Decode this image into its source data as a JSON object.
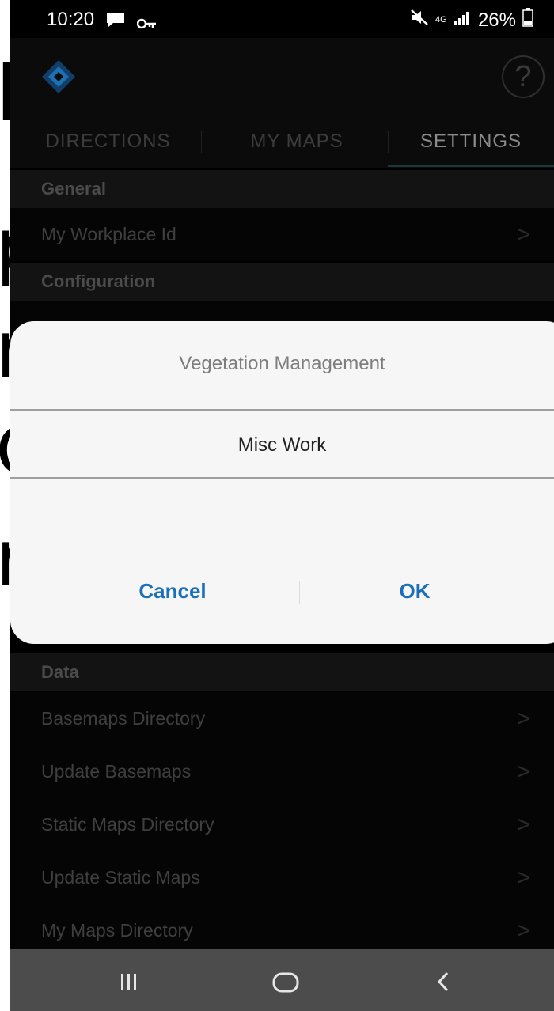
{
  "status_bar": {
    "time": "10:20",
    "network": "4G",
    "battery": "26%",
    "icons": [
      "chat-icon",
      "key-icon",
      "mute-icon",
      "signal-icon",
      "battery-icon"
    ]
  },
  "app_bar": {
    "logo_icon": "diamond-logo-icon",
    "help_icon": "help-icon",
    "help_glyph": "?"
  },
  "tabs": [
    {
      "label": "DIRECTIONS",
      "active": false
    },
    {
      "label": "MY MAPS",
      "active": false
    },
    {
      "label": "SETTINGS",
      "active": true
    }
  ],
  "sections": {
    "general": {
      "header": "General",
      "items": [
        {
          "label": "My Workplace Id"
        }
      ]
    },
    "configuration": {
      "header": "Configuration"
    },
    "data": {
      "header": "Data",
      "items": [
        {
          "label": "Basemaps Directory"
        },
        {
          "label": "Update Basemaps"
        },
        {
          "label": "Static Maps Directory"
        },
        {
          "label": "Update Static Maps"
        },
        {
          "label": "My Maps Directory"
        }
      ]
    }
  },
  "dialog": {
    "title": "Vegetation Management",
    "option": "Misc Work",
    "cancel_label": "Cancel",
    "ok_label": "OK"
  },
  "nav_bar": {
    "icons": [
      "recent-apps-icon",
      "home-icon",
      "back-icon"
    ]
  },
  "colors": {
    "accent": "#1a6fb8",
    "logo": "#1f6fb5",
    "dialog_bg": "#f6f6f6",
    "nav_bar_bg": "#4c4c4c"
  }
}
